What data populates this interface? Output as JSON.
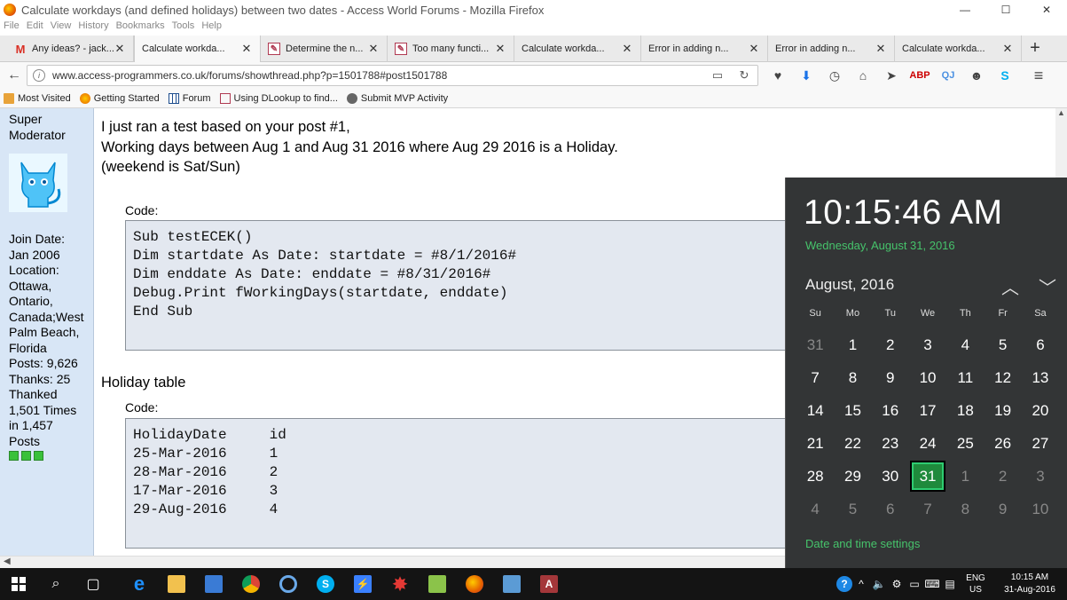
{
  "window": {
    "title": "Calculate workdays (and defined holidays) between two dates - Access World Forums - Mozilla Firefox",
    "min": "—",
    "max": "☐",
    "close": "✕"
  },
  "menu": [
    "File",
    "Edit",
    "View",
    "History",
    "Bookmarks",
    "Tools",
    "Help"
  ],
  "tabs": [
    {
      "label": "Any ideas? - jack...",
      "icon": "gmail"
    },
    {
      "label": "Calculate workda...",
      "icon": "grid",
      "active": true
    },
    {
      "label": "Determine the n...",
      "icon": "edit"
    },
    {
      "label": "Too many functi...",
      "icon": "edit"
    },
    {
      "label": "Calculate workda...",
      "icon": "grid"
    },
    {
      "label": "Error in adding n...",
      "icon": "grid"
    },
    {
      "label": "Error in adding n...",
      "icon": "grid"
    },
    {
      "label": "Calculate workda...",
      "icon": "grid"
    }
  ],
  "nav": {
    "url": "www.access-programmers.co.uk/forums/showthread.php?p=1501788#post1501788"
  },
  "bookmarks": [
    "Most Visited",
    "Getting Started",
    "Forum",
    "Using DLookup to find...",
    "Submit MVP Activity"
  ],
  "sidebar": {
    "rank_line1": "Super",
    "rank_line2": "Moderator",
    "info": [
      "Join Date:",
      "Jan 2006",
      "Location:",
      "Ottawa,",
      "Ontario,",
      "Canada;West",
      "Palm Beach,",
      "Florida",
      "Posts: 9,626",
      "Thanks: 25",
      "Thanked",
      "1,501 Times",
      "in 1,457",
      "Posts"
    ]
  },
  "post": {
    "line1": "I just ran a test based on your post #1,",
    "line2": "Working days between Aug 1 and Aug 31 2016 where Aug 29 2016 is a Holiday.",
    "line3": "(weekend is Sat/Sun)",
    "code_label": "Code:",
    "code1": "Sub testECEK()\nDim startdate As Date: startdate = #8/1/2016#\nDim enddate As Date: enddate = #8/31/2016#\nDebug.Print fWorkingDays(startdate, enddate)\nEnd Sub",
    "holiday_heading": "Holiday table",
    "code2": "HolidayDate     id\n25-Mar-2016     1\n28-Mar-2016     2\n17-Mar-2016     3\n29-Aug-2016     4"
  },
  "calendar": {
    "time": "10:15:46 AM",
    "long_date": "Wednesday, August 31, 2016",
    "month": "August, 2016",
    "dow": [
      "Su",
      "Mo",
      "Tu",
      "We",
      "Th",
      "Fr",
      "Sa"
    ],
    "days": [
      [
        "31",
        "dim"
      ],
      [
        "1",
        ""
      ],
      [
        "2",
        ""
      ],
      [
        "3",
        ""
      ],
      [
        "4",
        ""
      ],
      [
        "5",
        ""
      ],
      [
        "6",
        ""
      ],
      [
        "7",
        ""
      ],
      [
        "8",
        ""
      ],
      [
        "9",
        ""
      ],
      [
        "10",
        ""
      ],
      [
        "11",
        ""
      ],
      [
        "12",
        ""
      ],
      [
        "13",
        ""
      ],
      [
        "14",
        ""
      ],
      [
        "15",
        ""
      ],
      [
        "16",
        ""
      ],
      [
        "17",
        ""
      ],
      [
        "18",
        ""
      ],
      [
        "19",
        ""
      ],
      [
        "20",
        ""
      ],
      [
        "21",
        ""
      ],
      [
        "22",
        ""
      ],
      [
        "23",
        ""
      ],
      [
        "24",
        ""
      ],
      [
        "25",
        ""
      ],
      [
        "26",
        ""
      ],
      [
        "27",
        ""
      ],
      [
        "28",
        ""
      ],
      [
        "29",
        ""
      ],
      [
        "30",
        ""
      ],
      [
        "31",
        "today"
      ],
      [
        "1",
        "dim"
      ],
      [
        "2",
        "dim"
      ],
      [
        "3",
        "dim"
      ],
      [
        "4",
        "dim"
      ],
      [
        "5",
        "dim"
      ],
      [
        "6",
        "dim"
      ],
      [
        "7",
        "dim"
      ],
      [
        "8",
        "dim"
      ],
      [
        "9",
        "dim"
      ],
      [
        "10",
        "dim"
      ]
    ],
    "settings": "Date and time settings"
  },
  "taskbar": {
    "lang1": "ENG",
    "lang2": "US",
    "time": "10:15 AM",
    "date": "31-Aug-2016"
  }
}
